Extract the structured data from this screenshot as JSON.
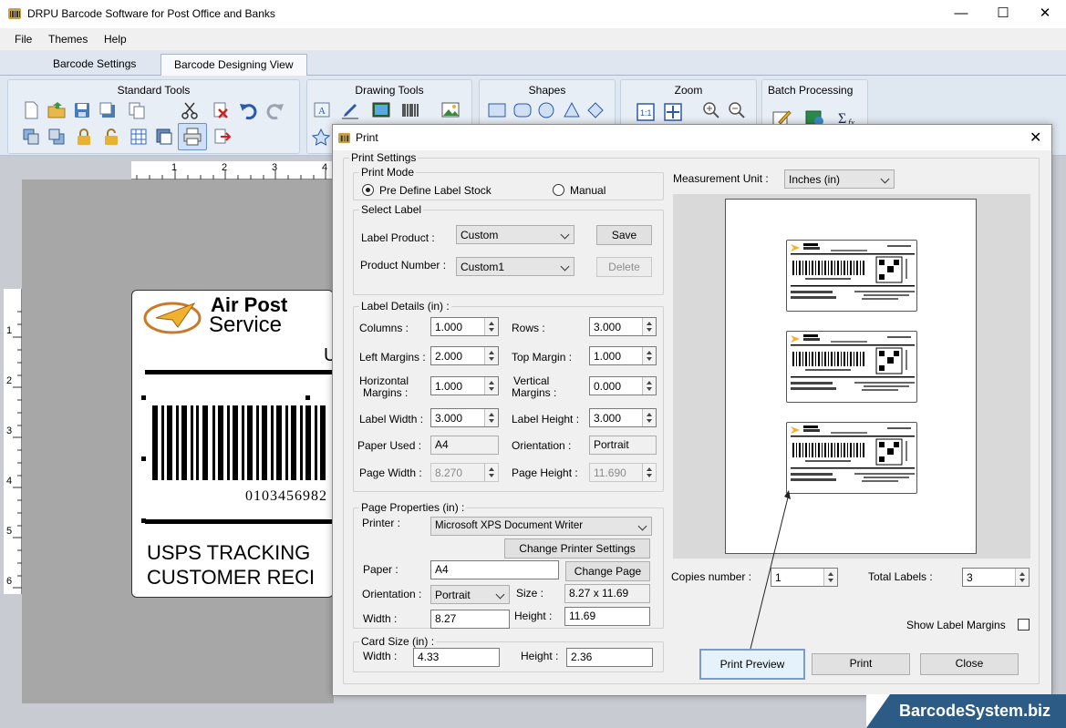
{
  "window": {
    "title": "DRPU Barcode Software for Post Office and Banks"
  },
  "menu": [
    "File",
    "Themes",
    "Help"
  ],
  "tabs": [
    "Barcode Settings",
    "Barcode Designing View"
  ],
  "ribbon": {
    "standard_tools": "Standard Tools",
    "drawing_tools": "Drawing Tools",
    "shapes": "Shapes",
    "zoom": "Zoom",
    "batch_processing": "Batch Processing"
  },
  "ruler": {
    "h": [
      "1",
      "2",
      "3",
      "4"
    ],
    "v": [
      "1",
      "2",
      "3",
      "4",
      "5",
      "6"
    ]
  },
  "label_canvas": {
    "company_line1": "Air Post",
    "company_line2": "Service",
    "corner_text": "U",
    "barcode_number": "0103456982",
    "footer_line1": "USPS TRACKING",
    "footer_line2": "CUSTOMER RECI"
  },
  "dialog": {
    "title": "Print",
    "print_settings": "Print Settings",
    "print_mode": {
      "legend": "Print Mode",
      "option1": "Pre Define Label Stock",
      "option2": "Manual",
      "selected": "Pre Define Label Stock"
    },
    "select_label": {
      "legend": "Select Label",
      "label_product_label": "Label Product :",
      "label_product_value": "Custom",
      "product_number_label": "Product Number :",
      "product_number_value": "Custom1",
      "save": "Save",
      "delete": "Delete"
    },
    "label_details": {
      "legend": "Label Details (in) :",
      "columns_label": "Columns :",
      "columns": "1.000",
      "rows_label": "Rows :",
      "rows": "3.000",
      "left_margins_label": "Left Margins :",
      "left_margins": "2.000",
      "top_margin_label": "Top Margin :",
      "top_margin": "1.000",
      "h_margins_label1": "Horizontal",
      "h_margins_label2": "Margins :",
      "h_margins": "1.000",
      "v_margins_label1": "Vertical",
      "v_margins_label2": "Margins :",
      "v_margins": "0.000",
      "label_width_label": "Label Width :",
      "label_width": "3.000",
      "label_height_label": "Label Height :",
      "label_height": "3.000",
      "paper_used_label": "Paper Used :",
      "paper_used": "A4",
      "orientation_label": "Orientation :",
      "orientation": "Portrait",
      "page_width_label": "Page Width :",
      "page_width": "8.270",
      "page_height_label": "Page Height :",
      "page_height": "11.690"
    },
    "page_properties": {
      "legend": "Page Properties (in) :",
      "printer_label": "Printer :",
      "printer": "Microsoft XPS Document Writer",
      "change_printer": "Change Printer Settings",
      "paper_label": "Paper :",
      "paper": "A4",
      "change_page": "Change Page",
      "orientation_label": "Orientation :",
      "orientation": "Portrait",
      "size_label": "Size :",
      "size": "8.27 x 11.69",
      "width_label": "Width :",
      "width": "8.27",
      "height_label": "Height :",
      "height": "11.69"
    },
    "card_size": {
      "legend": "Card Size (in) :",
      "width_label": "Width :",
      "width": "4.33",
      "height_label": "Height :",
      "height": "2.36"
    },
    "measurement_unit_label": "Measurement Unit :",
    "measurement_unit": "Inches (in)",
    "copies_label": "Copies number :",
    "copies": "1",
    "total_labels_label": "Total Labels :",
    "total_labels": "3",
    "show_label_margins": "Show Label Margins",
    "print_preview": "Print Preview",
    "print": "Print",
    "close": "Close"
  },
  "watermark": "BarcodeSystem.biz",
  "accent": "#1a5fb4"
}
